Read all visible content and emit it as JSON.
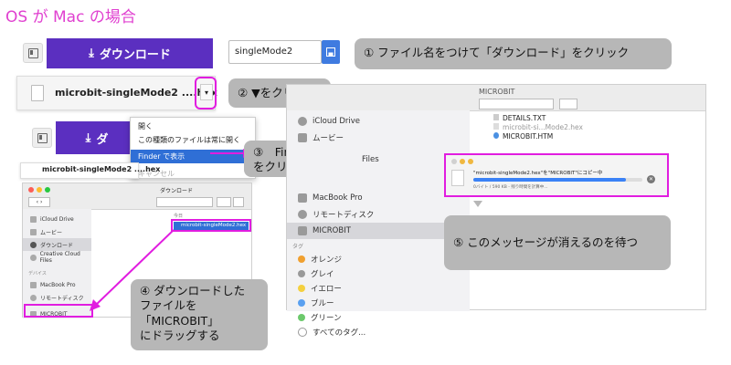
{
  "title": "OS が Mac の場合",
  "row1": {
    "download_label": "ダウンロード",
    "filename_value": "singleMode2"
  },
  "row2": {
    "file_name": "microbit-singleMode2 ....hex"
  },
  "row3": {
    "download_label": "ダ"
  },
  "context_menu": {
    "items": [
      "開く",
      "この種類のファイルは常に開く",
      "Finder で表示",
      "キャンセル"
    ]
  },
  "small_chip": {
    "file_name": "microbit-singleMode2 ....hex"
  },
  "callouts": {
    "step1": "① ファイル名をつけて「ダウンロード」をクリック",
    "step2": "② ▼をクリック",
    "step3": "③　Finder で表示\nをクリック",
    "step4": "④ ダウンロードした\nファイルを\n「MICROBIT」\nにドラッグする",
    "step5": "⑤ このメッセージが消えるのを待つ"
  },
  "finder_small": {
    "title": "ダウンロード",
    "col_header": "今日",
    "file": "microbit-singleMode2.hex",
    "sidebar": [
      "iCloud Drive",
      "ムービー",
      "ダウンロード",
      "Creative Cloud Files"
    ],
    "devices_label": "デバイス",
    "devices": [
      "MacBook Pro",
      "リモートディスク",
      "MICROBIT"
    ]
  },
  "finder_big": {
    "title": "MICROBIT",
    "sidebar_top": [
      "iCloud Drive",
      "ムービー"
    ],
    "partial_label": "Files",
    "devices": [
      "MacBook Pro",
      "リモートディスク",
      "MICROBIT"
    ],
    "tags_label": "タグ",
    "tags": [
      "オレンジ",
      "グレイ",
      "イエロー",
      "ブルー",
      "グリーン",
      "すべてのタグ..."
    ],
    "files": [
      "DETAILS.TXT",
      "microbit-si...Mode2.hex",
      "MICROBIT.HTM"
    ]
  },
  "copy_dialog": {
    "message": "\"microbit-singleMode2.hex\"を\"MICROBIT\"にコピー中",
    "progress_text": "0バイト / 590 KB - 残り時間を計算中...",
    "progress": 0.9
  },
  "colors": {
    "accent": "#5b2fc0",
    "highlight": "#e11de0",
    "callout": "#b7b7b7",
    "save": "#3f7be0"
  }
}
